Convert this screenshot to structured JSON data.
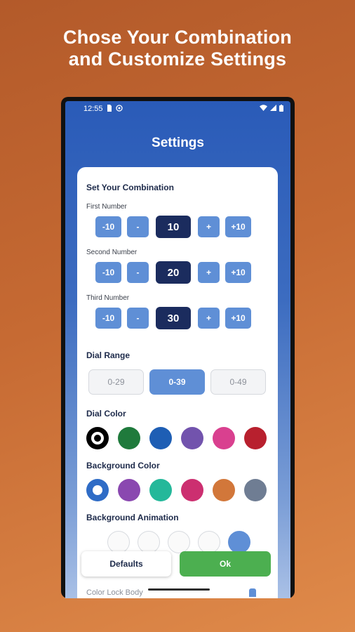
{
  "headline": {
    "line1": "Chose Your Combination",
    "line2": "and Customize Settings"
  },
  "status_bar": {
    "time": "12:55",
    "icons": [
      "sim-icon",
      "vpn-icon",
      "wifi-icon",
      "signal-icon",
      "battery-icon"
    ]
  },
  "screen": {
    "title": "Settings"
  },
  "combination": {
    "title": "Set Your Combination",
    "numbers": [
      {
        "label": "First Number",
        "value": "10"
      },
      {
        "label": "Second Number",
        "value": "20"
      },
      {
        "label": "Third Number",
        "value": "30"
      }
    ],
    "controls": {
      "minus_ten": "-10",
      "minus": "-",
      "plus": "+",
      "plus_ten": "+10"
    }
  },
  "dial_range": {
    "title": "Dial Range",
    "options": [
      "0-29",
      "0-39",
      "0-49"
    ],
    "selected": "0-39"
  },
  "dial_color": {
    "title": "Dial Color",
    "swatches": [
      "#000000",
      "#1f7a3c",
      "#1e5eb4",
      "#7253ad",
      "#d9408f",
      "#b8202e"
    ],
    "selected_index": 0
  },
  "background_color": {
    "title": "Background Color",
    "swatches": [
      "#2f6cc6",
      "#8a48b0",
      "#24b89a",
      "#cc2f70",
      "#d2773a",
      "#6f7d93"
    ],
    "selected_index": 0
  },
  "background_animation": {
    "title": "Background Animation",
    "selected_index": 4
  },
  "peek": {
    "label": "Color Lock Body"
  },
  "footer": {
    "defaults_label": "Defaults",
    "ok_label": "Ok"
  },
  "colors": {
    "accent": "#5f8fd6",
    "value_box": "#1b2c5e",
    "ok_green": "#4caf50"
  }
}
